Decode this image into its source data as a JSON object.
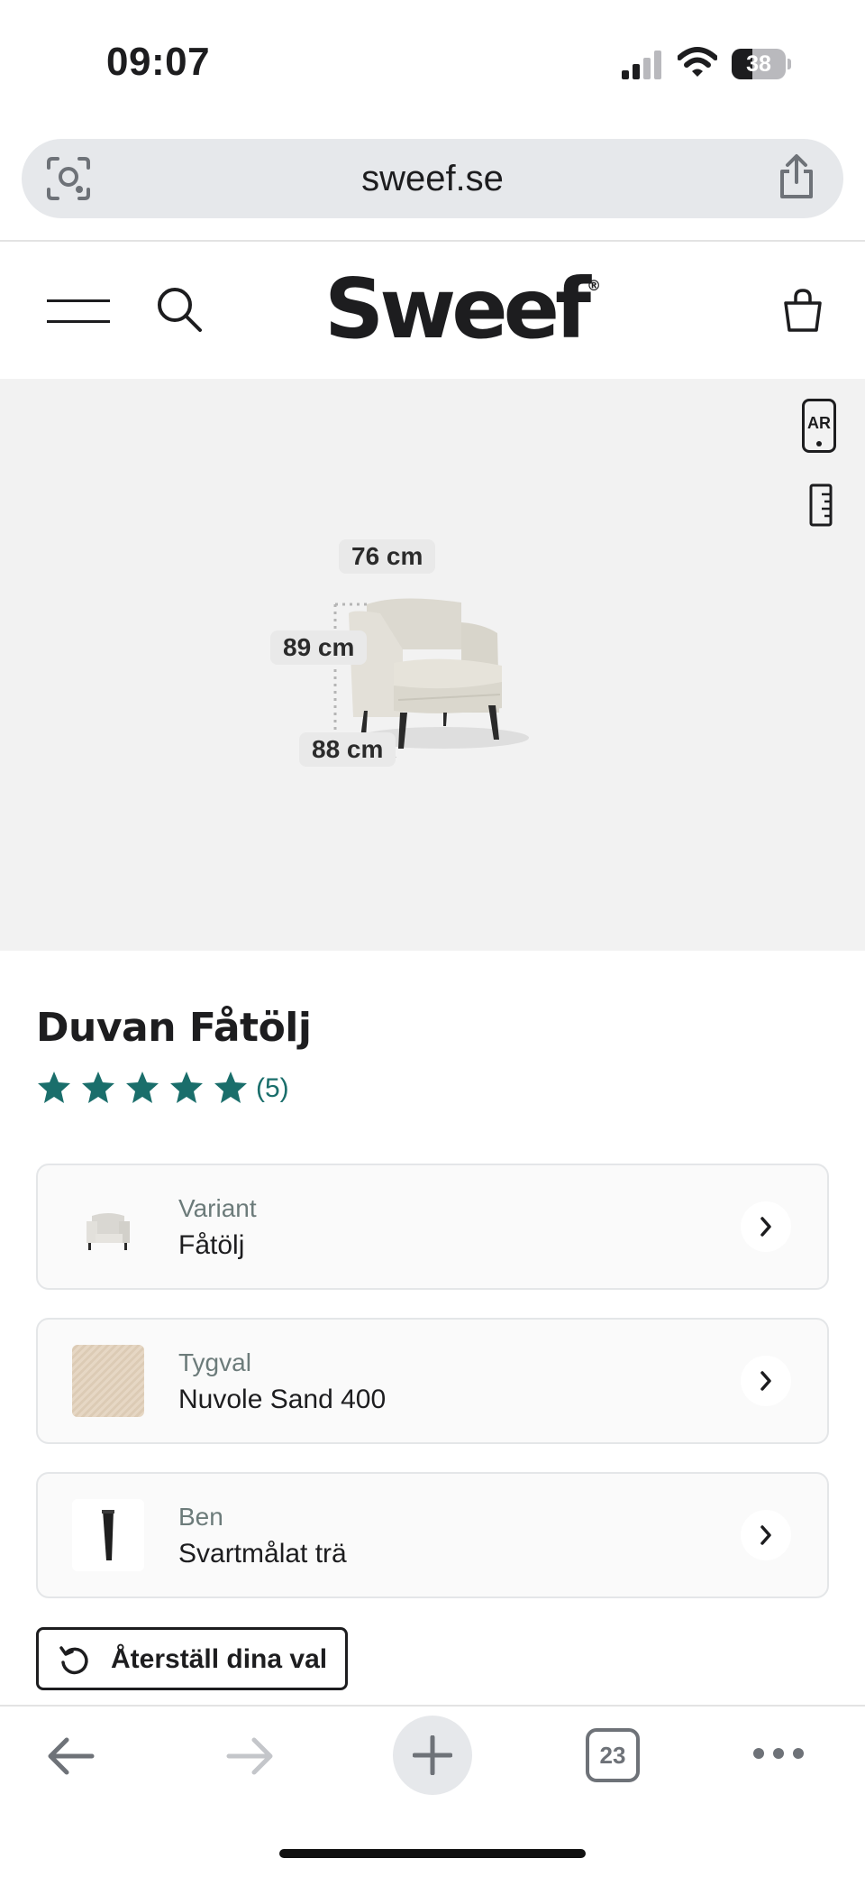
{
  "status_bar": {
    "time": "09:07",
    "battery_level": "38",
    "icons": [
      "cellular-signal-icon",
      "wifi-icon",
      "battery-icon"
    ]
  },
  "browser": {
    "url": "sweef.se",
    "icons": [
      "visual-search-icon",
      "share-icon"
    ]
  },
  "site_header": {
    "logo_text": "Sweef",
    "logo_mark": "®",
    "icons": [
      "hamburger-menu-icon",
      "search-icon",
      "shopping-bag-icon"
    ]
  },
  "hero": {
    "ar_label": "AR",
    "dimensions": {
      "width": "76 cm",
      "height": "89 cm",
      "depth": "88 cm"
    },
    "icons": [
      "ar-phone-icon",
      "ruler-icon"
    ]
  },
  "product": {
    "title": "Duvan Fåtölj",
    "rating_stars": 5,
    "review_count": "(5)",
    "star_color": "#1a6e6b"
  },
  "options": [
    {
      "label": "Variant",
      "value": "Fåtölj",
      "thumb": "armchair-thumbnail"
    },
    {
      "label": "Tygval",
      "value": "Nuvole Sand 400",
      "thumb": "fabric-swatch"
    },
    {
      "label": "Ben",
      "value": "Svartmålat trä",
      "thumb": "leg-thumbnail"
    }
  ],
  "reset_button": {
    "label": "Återställ dina val"
  },
  "toolbar": {
    "tabs_count": "23",
    "icons": [
      "back-arrow-icon",
      "forward-arrow-icon",
      "plus-icon",
      "tabs-icon",
      "more-icon"
    ]
  }
}
